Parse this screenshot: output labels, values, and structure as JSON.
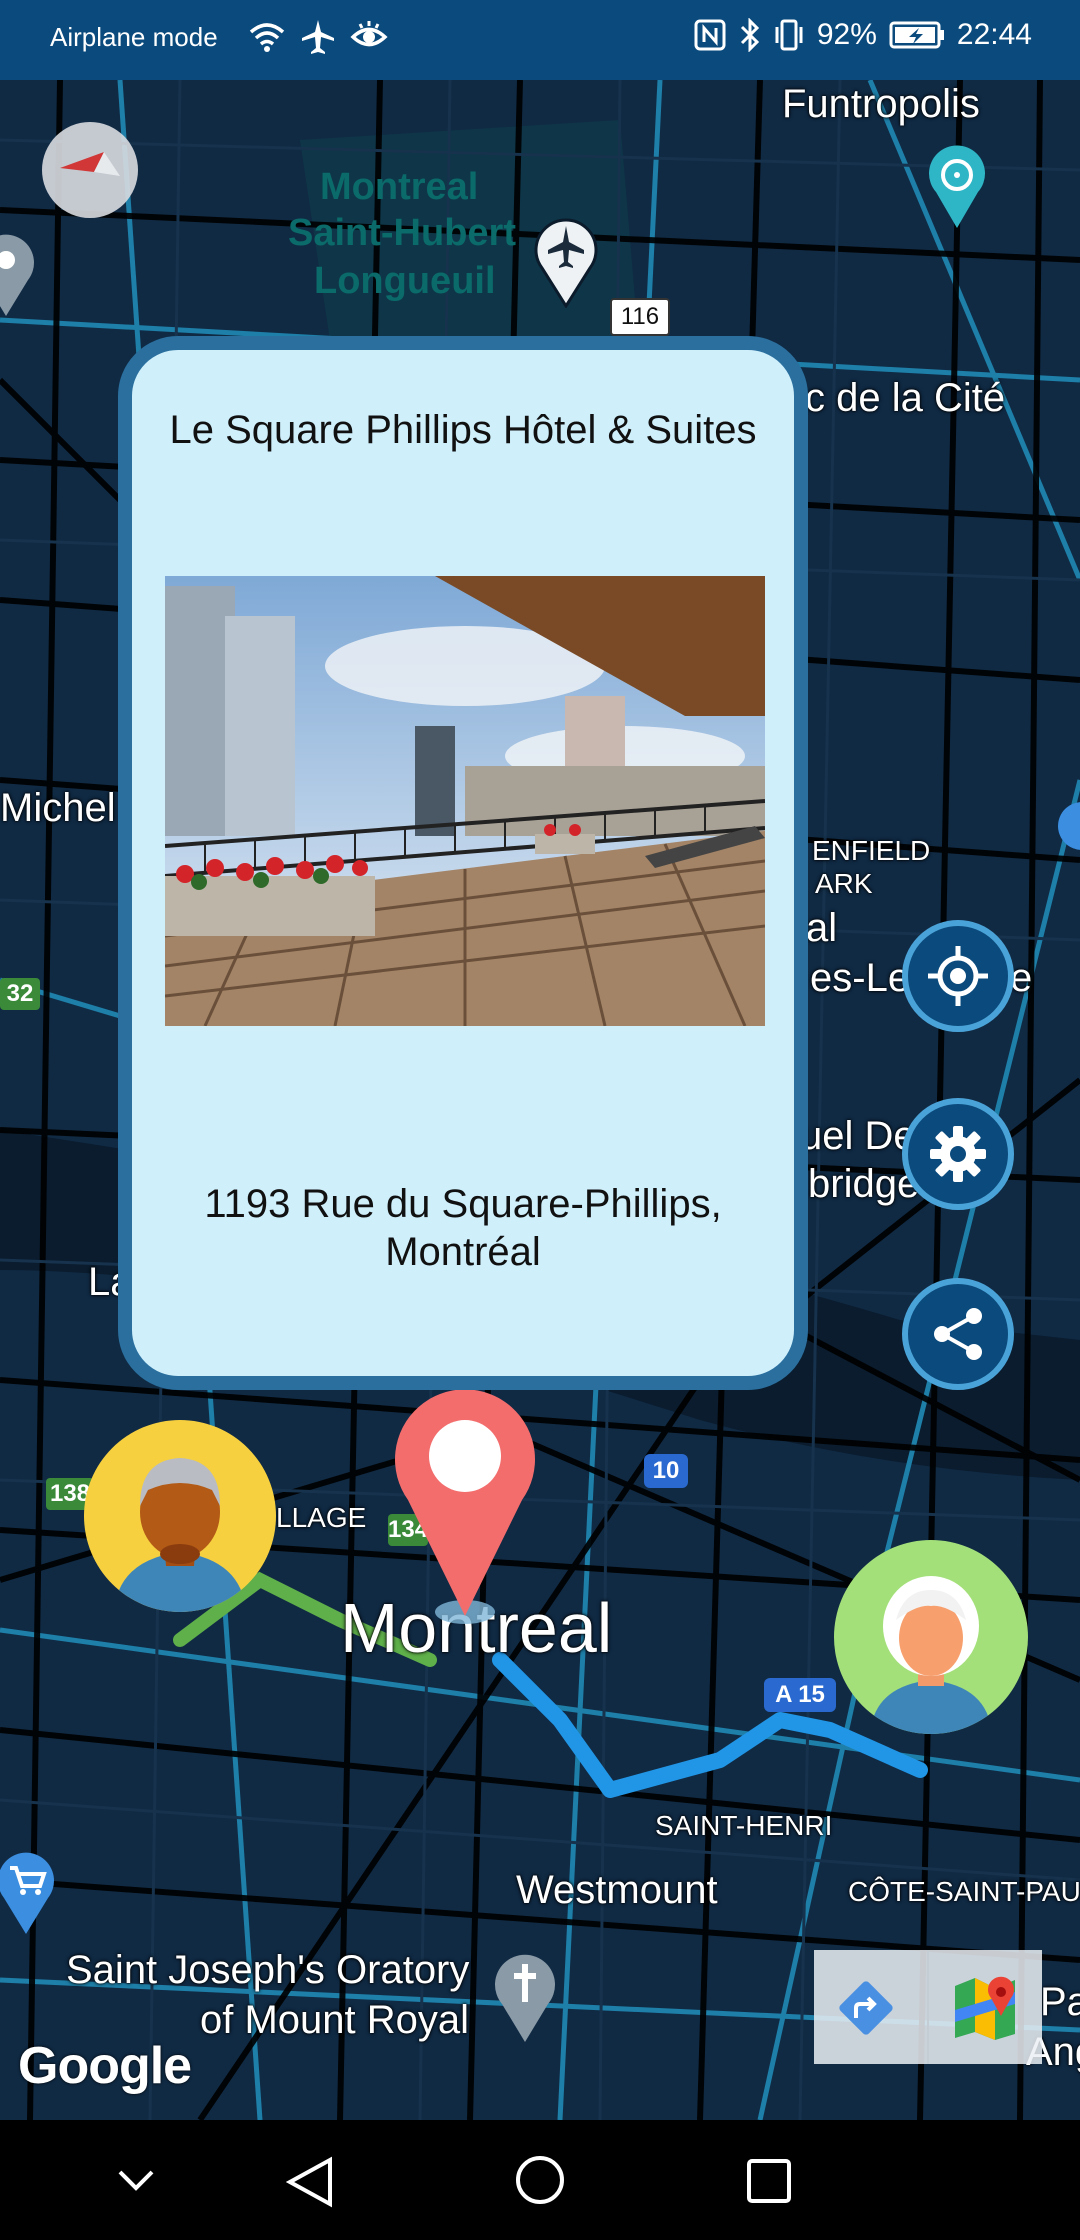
{
  "status_bar": {
    "mode_text": "Airplane mode",
    "battery": "92%",
    "time": "22:44",
    "icons": [
      "wifi-icon",
      "airplane-icon",
      "eye-icon",
      "nfc-icon",
      "bluetooth-icon",
      "vibrate-icon",
      "battery-charging-icon"
    ]
  },
  "map": {
    "place_labels": {
      "funtropolis": "Funtropolis",
      "airport_line1": "Montreal",
      "airport_line2": "Saint-Hubert",
      "airport_line3": "Longueuil",
      "cite": "c de la Cité",
      "michel": "Michel",
      "penfield": "ENFIELD",
      "park": "ARK",
      "al": "al",
      "les_le": "es-Le",
      "e": "e",
      "uel_de": "uel De",
      "bridge": "bridge",
      "la": "La",
      "village": "LLAGE",
      "montreal": "Montreal",
      "saint_henri": "SAINT-HENRI",
      "westmount": "Westmount",
      "cote_saint_paul": "CÔTE-SAINT-PAUL",
      "oratory_line1": "Saint Joseph's Oratory",
      "oratory_line2": "of Mount Royal",
      "pa": "Pa",
      "angri": "Angri"
    },
    "road_shields": {
      "r116": "116",
      "r32": "32",
      "r138": "138",
      "r134": "134",
      "r10": "10",
      "a15": "A 15"
    },
    "attribution": "Google"
  },
  "popup": {
    "title": "Le Square Phillips Hôtel & Suites",
    "address": "1193 Rue du Square-Phillips, Montréal"
  },
  "colors": {
    "status_bar": "#0b4a7c",
    "map_bg": "#102a44",
    "road": "#000000",
    "road_highlight": "#1e7fa8",
    "popup_bg": "#cfeffb",
    "popup_border": "#2a6f9e",
    "fab_bg": "#0b4a7c",
    "route_blue": "#2196e6",
    "route_green": "#5fb04a",
    "marker_red": "#f36d6d"
  }
}
